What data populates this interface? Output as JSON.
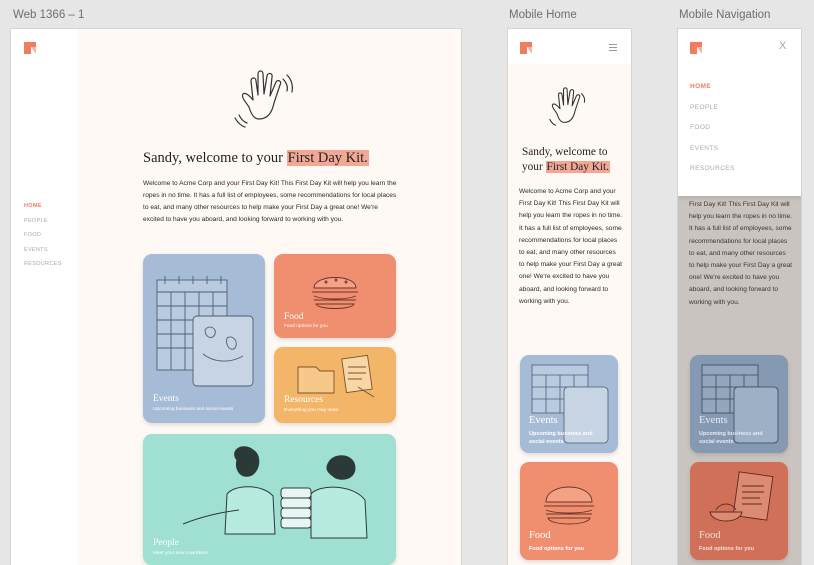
{
  "artboards": {
    "web": "Web 1366 – 1",
    "mobile_home": "Mobile Home",
    "mobile_nav": "Mobile Navigation"
  },
  "nav": [
    "HOME",
    "PEOPLE",
    "FOOD",
    "EVENTS",
    "RESOURCES"
  ],
  "hero": {
    "title_prefix": "Sandy, welcome to your ",
    "title_highlight": "First Day Kit.",
    "mobile_title_line1": "Sandy, welcome to",
    "mobile_title_prefix2": "your ",
    "body": "Welcome to Acme Corp and your First Day Kit! This First Day Kit will help you learn the ropes in no time. It has a full list of employees, some recommendations for local places to eat, and many other resources to help make your First Day a great one! We're excited to have you aboard, and looking forward to working with you.",
    "mobile_nav_body": "First Day Kit! This First Day Kit will help you learn the ropes in no time. It has a full list of employees, some recommendations for local places to eat, and many other resources to help make your First Day a great one! We're excited to have you aboard, and looking forward to working with you."
  },
  "cards": {
    "events": {
      "title": "Events",
      "sub": "Upcoming business and social events",
      "mobile_sub": "Upcoming business and social events"
    },
    "food": {
      "title": "Food",
      "sub": "Food options for you"
    },
    "resources": {
      "title": "Resources",
      "sub": "Everything you may need"
    },
    "people": {
      "title": "People",
      "sub": "Meet your new coworkers"
    }
  },
  "icons": {
    "close": "X",
    "logo": "brand-logo-icon",
    "menu": "hamburger-icon"
  },
  "colors": {
    "accent": "#ef7d5f",
    "events": "#a6bcd6",
    "food": "#f08f70",
    "resources": "#f3b668",
    "people": "#9fe0d2",
    "highlight": "#f3a896"
  }
}
